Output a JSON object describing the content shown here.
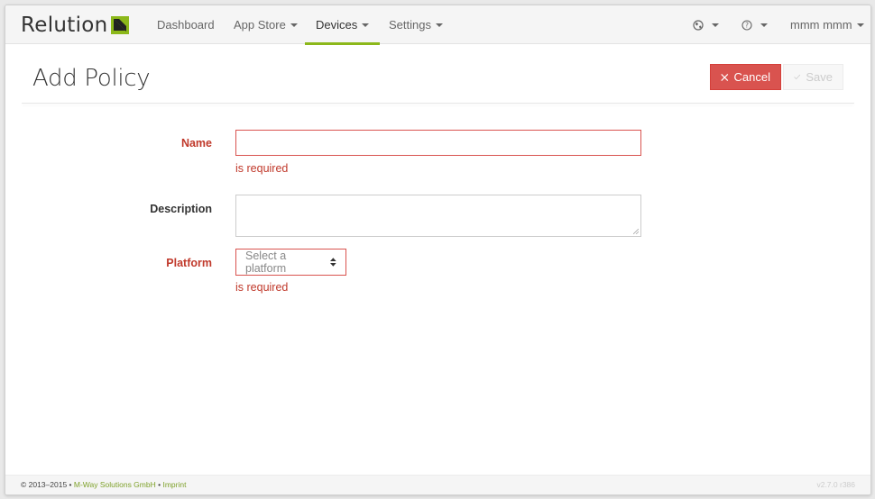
{
  "app": {
    "brand": "Relution",
    "accent_color": "#8cb81a",
    "danger_color": "#d9534f"
  },
  "navbar": {
    "items": [
      {
        "label": "Dashboard",
        "has_dropdown": false,
        "active": false
      },
      {
        "label": "App Store",
        "has_dropdown": true,
        "active": false
      },
      {
        "label": "Devices",
        "has_dropdown": true,
        "active": true
      },
      {
        "label": "Settings",
        "has_dropdown": true,
        "active": false
      }
    ],
    "right": {
      "globe_icon": "globe-icon",
      "help_icon": "help-icon",
      "user_label": "mmm mmm"
    }
  },
  "page": {
    "title": "Add Policy",
    "cancel_label": "Cancel",
    "save_label": "Save"
  },
  "form": {
    "name": {
      "label": "Name",
      "value": "",
      "error": "is required"
    },
    "description": {
      "label": "Description",
      "value": ""
    },
    "platform": {
      "label": "Platform",
      "placeholder": "Select a platform",
      "error": "is required"
    }
  },
  "footer": {
    "copyright": "© 2013–2015 •",
    "company": "M-Way Solutions GmbH",
    "separator": "•",
    "imprint": "Imprint",
    "version": "v2.7.0 r386"
  }
}
